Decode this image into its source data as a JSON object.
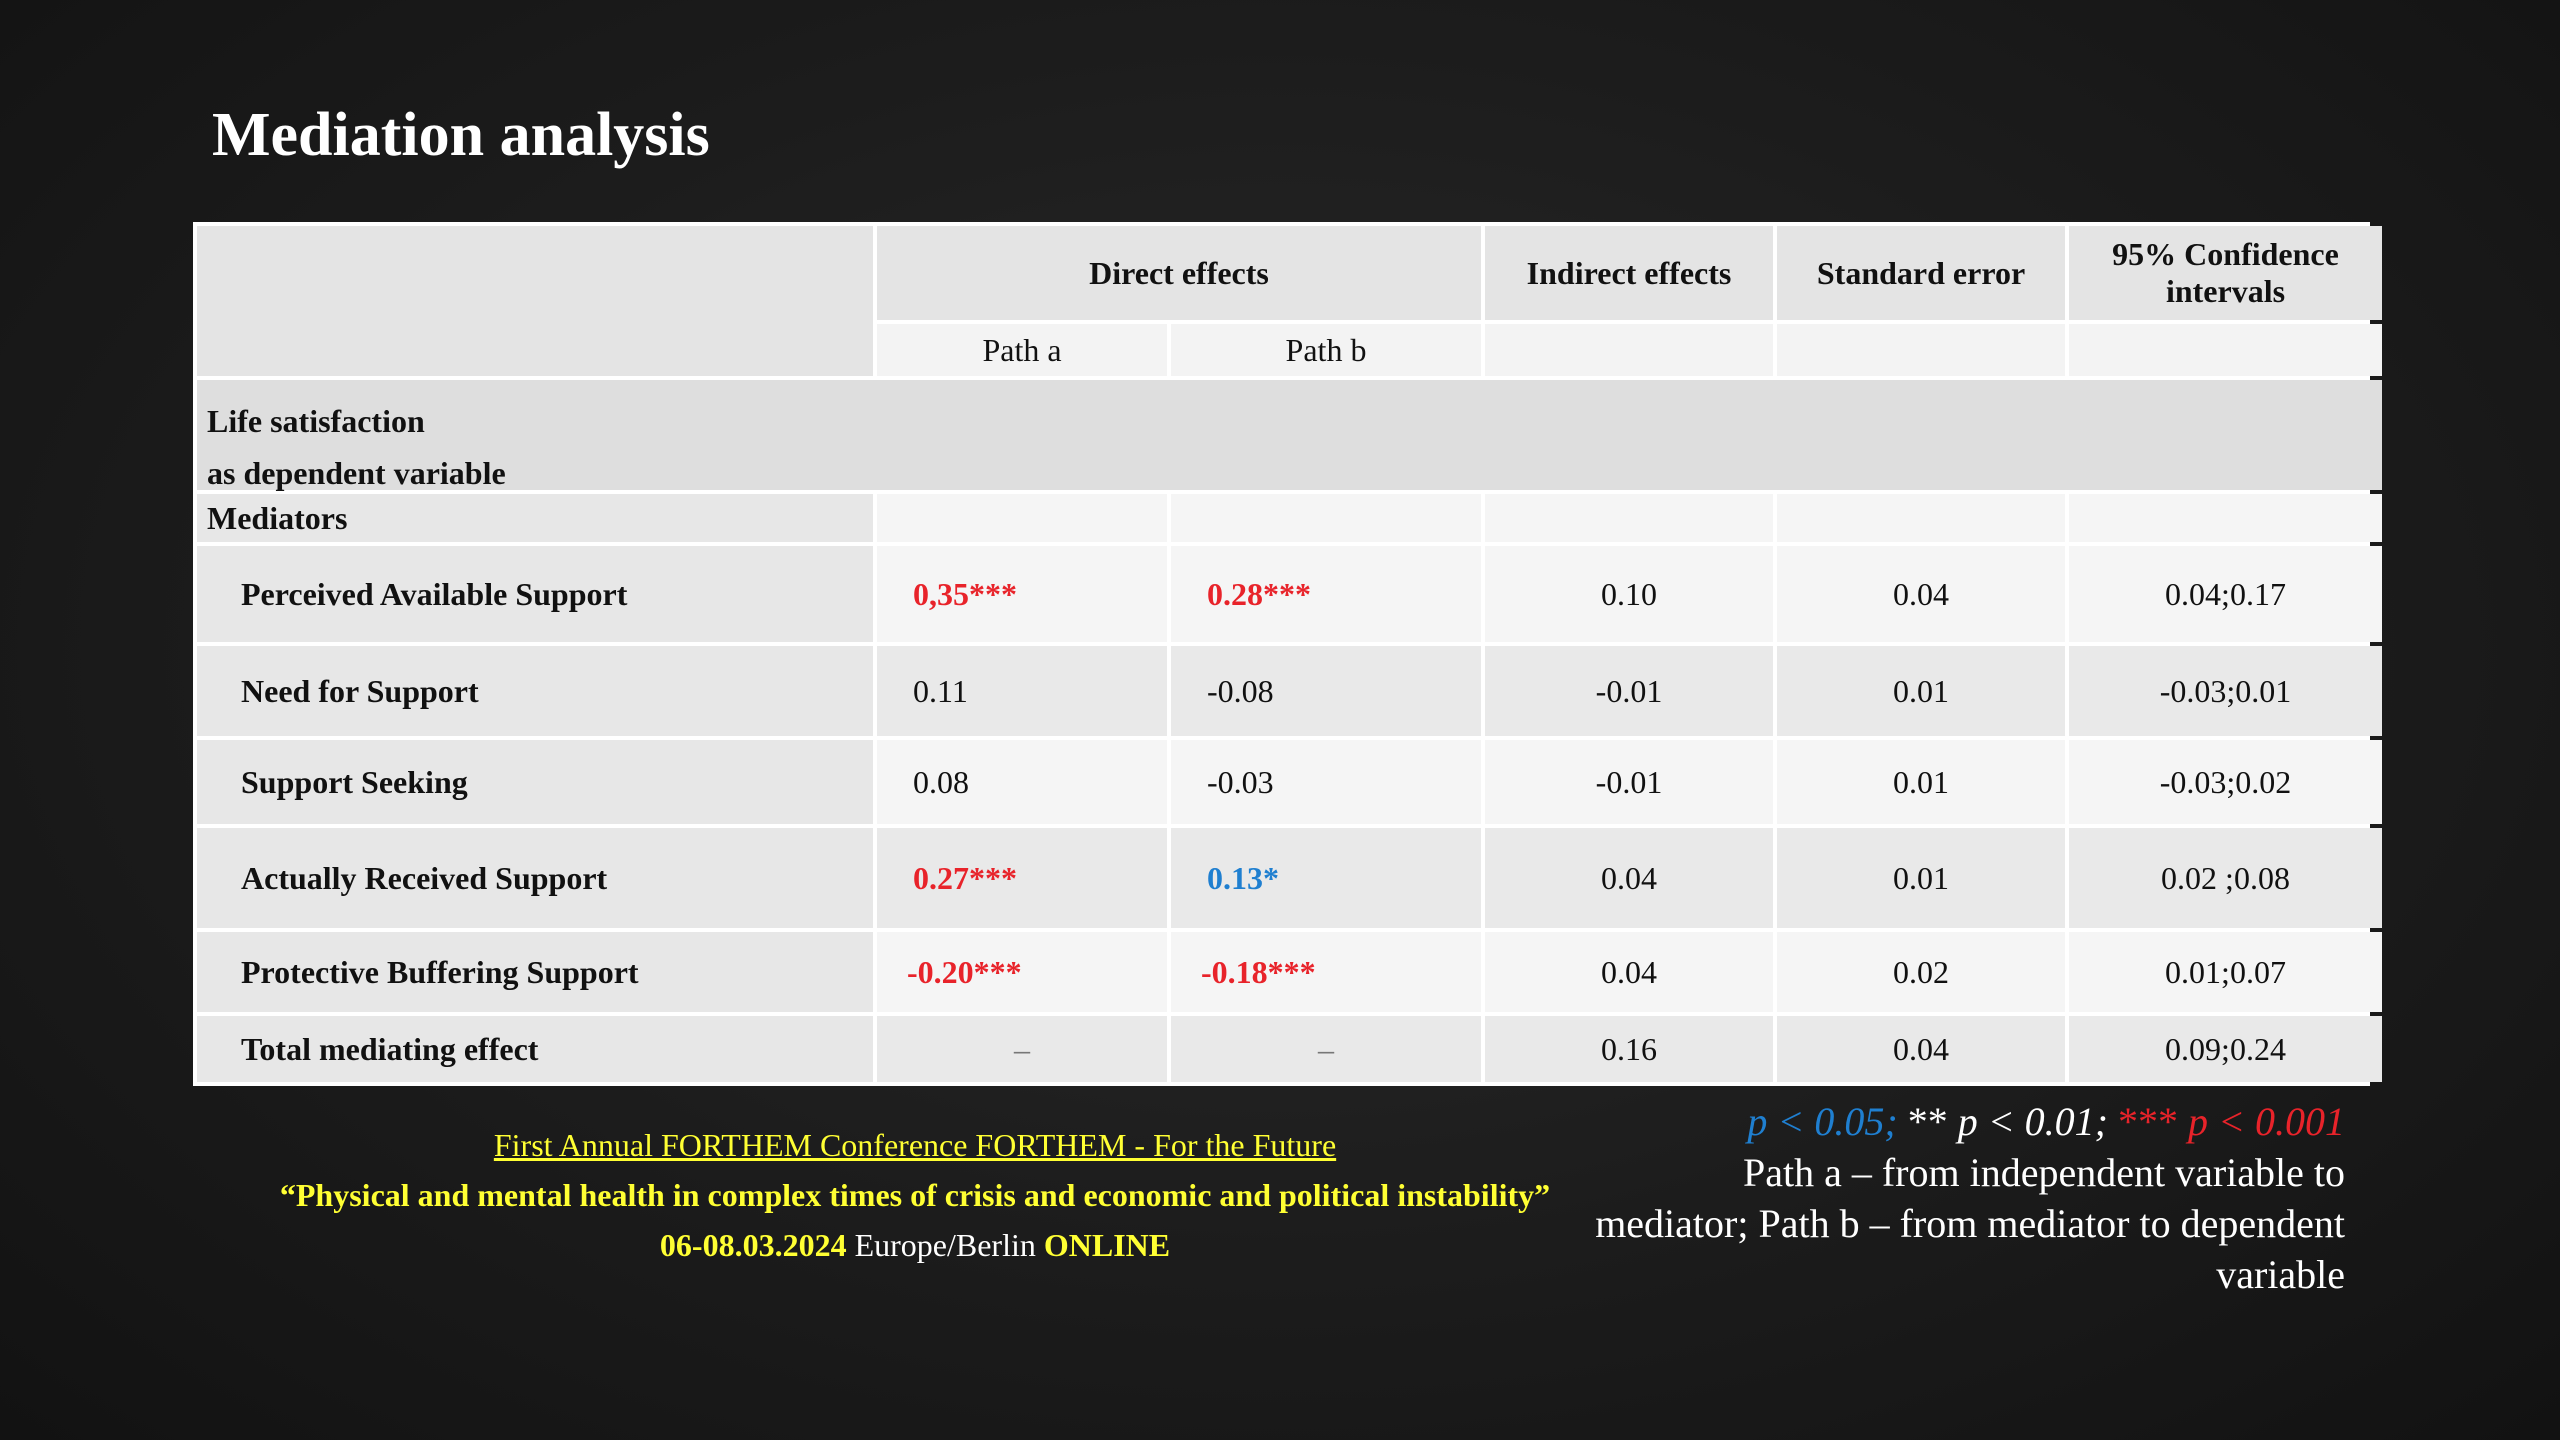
{
  "title": "Mediation analysis",
  "table": {
    "headers": {
      "direct": "Direct effects",
      "indirect": "Indirect effects",
      "se": "Standard error",
      "ci": "95% Confidence intervals",
      "path_a": "Path a",
      "path_b": "Path b"
    },
    "section_label_1": "Life satisfaction",
    "section_label_2": "as dependent variable",
    "mediators_label": "Mediators",
    "rows": [
      {
        "label": "Perceived Available Support",
        "a": "0,35***",
        "b": "0.28***",
        "ind": "0.10",
        "se": "0.04",
        "ci": "0.04;0.17"
      },
      {
        "label": "Need for Support",
        "a": "0.11",
        "b": "-0.08",
        "ind": "-0.01",
        "se": "0.01",
        "ci": "-0.03;0.01"
      },
      {
        "label": "Support Seeking",
        "a": "0.08",
        "b": "-0.03",
        "ind": "-0.01",
        "se": "0.01",
        "ci": "-0.03;0.02"
      },
      {
        "label": "Actually Received Support",
        "a": "0.27***",
        "b": "0.13*",
        "ind": "0.04",
        "se": "0.01",
        "ci": "0.02 ;0.08"
      },
      {
        "label": "Protective Buffering Support",
        "a": "-0.20***",
        "b": "-0.18***",
        "ind": "0.04",
        "se": "0.02",
        "ci": "0.01;0.07"
      },
      {
        "label": "Total mediating effect",
        "a": "–",
        "b": "–",
        "ind": "0.16",
        "se": "0.04",
        "ci": "0.09;0.24"
      }
    ]
  },
  "footer": {
    "conference": "First Annual FORTHEM Conference FORTHEM - For the Future",
    "quote": "“Physical and mental health in complex times of crisis and economic and political instability”",
    "date": "06-08.03.2024",
    "location": "Europe/Berlin",
    "mode": "ONLINE"
  },
  "legend": {
    "p05": "p < 0.05;",
    "stars2": "** ",
    "p01": "p < 0.01;",
    "stars3": "***",
    "p001": "p < 0.001",
    "paths": "Path a – from independent variable to mediator; Path b – from mediator to dependent variable"
  },
  "colors": {
    "significant_red": "#e8232a",
    "significant_blue": "#1f7fd0",
    "footer_yellow": "#ffff33"
  }
}
